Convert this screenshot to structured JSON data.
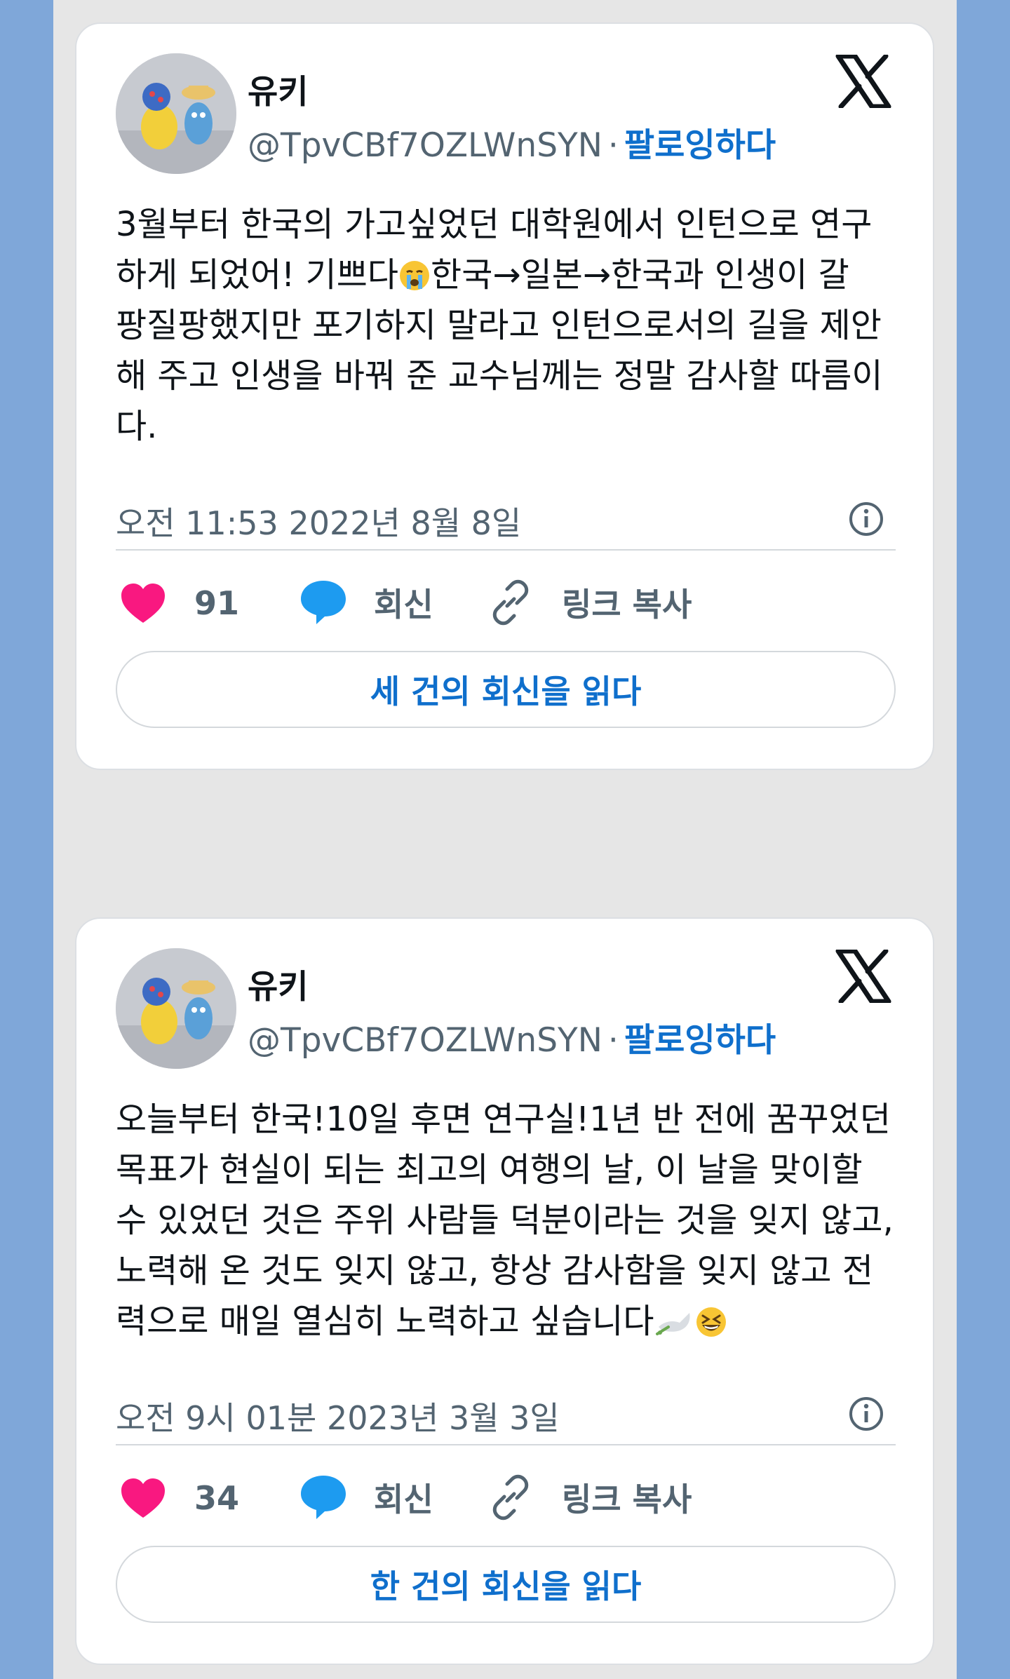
{
  "posts": [
    {
      "name": "유키",
      "handle": "@TpvCBf7OZLWnSYN",
      "separator": "·",
      "follow": "팔로잉하다",
      "text_lines": [
        "3월부터 한국의 가고싶었던 대학원에서 인턴으로 연구",
        "하게 되었어! 기쁘다",
        "한국→일본→한국과 인생이 갈",
        "팡질팡했지만 포기하지 말라고 인턴으로서의 길을 제안",
        "해 주고 인생을 바꿔 준 교수님께는 정말 감사할 따름이",
        "다."
      ],
      "time": "오전 11:53 2022년 8월 8일",
      "likes": "91",
      "reply_label": "회신",
      "copy_label": "링크 복사",
      "read_replies": "세 건의 회신을 읽다"
    },
    {
      "name": "유키",
      "handle": "@TpvCBf7OZLWnSYN",
      "separator": "·",
      "follow": "팔로잉하다",
      "text_lines": [
        "오늘부터 한국!10일 후면 연구실!1년 반 전에 꿈꾸었던",
        "목표가 현실이 되는 최고의 여행의 날, 이 날을 맞이할",
        "수 있었던 것은 주위 사람들 덕분이라는 것을 잊지 않고,",
        "노력해 온 것도 잊지 않고, 항상 감사함을 잊지 않고 전",
        "력으로 매일 열심히 노력하고 싶습니다"
      ],
      "time": "오전 9시 01분 2023년 3월 3일",
      "likes": "34",
      "reply_label": "회신",
      "copy_label": "링크 복사",
      "read_replies": "한 건의 회신을 읽다"
    }
  ],
  "colors": {
    "like": "#f91880",
    "reply": "#1d9bf0",
    "link": "#0f6fcc",
    "secondary": "#536471"
  },
  "icons": [
    "x-logo-icon",
    "info-icon",
    "heart-icon",
    "reply-bubble-icon",
    "link-icon",
    "crying-face-emoji",
    "dove-emoji",
    "grinning-squint-emoji"
  ]
}
